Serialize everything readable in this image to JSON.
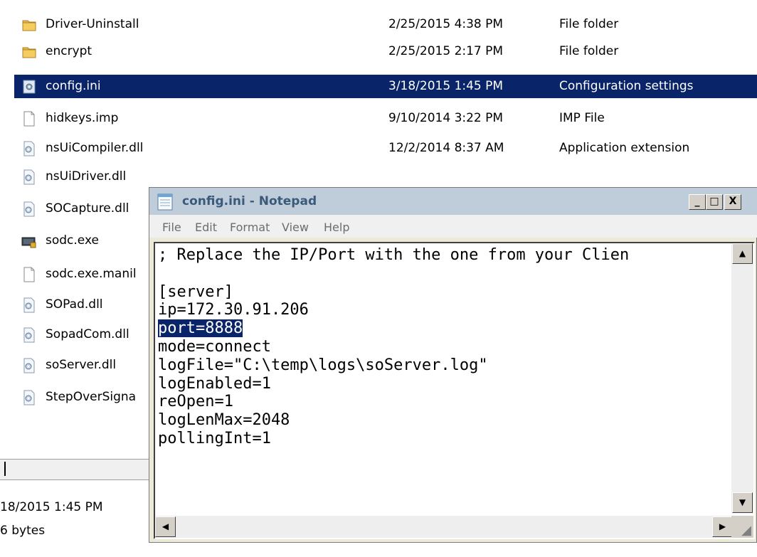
{
  "explorer": {
    "files": [
      {
        "name": "Driver-Uninstall",
        "date": "2/25/2015 4:38 PM",
        "type": "File folder",
        "icon": "folder-icon"
      },
      {
        "name": "encrypt",
        "date": "2/25/2015 2:17 PM",
        "type": "File folder",
        "icon": "folder-icon"
      },
      {
        "name": "config.ini",
        "date": "3/18/2015 1:45 PM",
        "type": "Configuration settings",
        "icon": "config-file-icon",
        "selected": true
      },
      {
        "name": "hidkeys.imp",
        "date": "9/10/2014 3:22 PM",
        "type": "IMP File",
        "icon": "blank-file-icon"
      },
      {
        "name": "nsUiCompiler.dll",
        "date": "12/2/2014 8:37 AM",
        "type": "Application extension",
        "icon": "dll-file-icon"
      },
      {
        "name": "nsUiDriver.dll",
        "date": "",
        "type": "",
        "icon": "dll-file-icon"
      },
      {
        "name": "SOCapture.dll",
        "date": "",
        "type": "",
        "icon": "dll-file-icon"
      },
      {
        "name": "sodc.exe",
        "date": "",
        "type": "",
        "icon": "exe-file-icon"
      },
      {
        "name": "sodc.exe.manil",
        "date": "",
        "type": "",
        "icon": "blank-file-icon"
      },
      {
        "name": "SOPad.dll",
        "date": "",
        "type": "",
        "icon": "dll-file-icon"
      },
      {
        "name": "SopadCom.dll",
        "date": "",
        "type": "",
        "icon": "dll-file-icon"
      },
      {
        "name": "soServer.dll",
        "date": "",
        "type": "",
        "icon": "dll-file-icon"
      },
      {
        "name": "StepOverSigna",
        "date": "",
        "type": "",
        "icon": "dll-file-icon"
      }
    ],
    "details": {
      "modified": "18/2015 1:45 PM",
      "size": "6 bytes"
    }
  },
  "notepad": {
    "title": "config.ini - Notepad",
    "menu": [
      "File",
      "Edit",
      "Format",
      "View",
      "Help"
    ],
    "lines": [
      "; Replace the IP/Port with the one from your Clien",
      "",
      "[server]",
      "ip=172.30.91.206",
      "port=8888",
      "mode=connect",
      "logFile=\"C:\\temp\\logs\\soServer.log\"",
      "logEnabled=1",
      "reOpen=1",
      "logLenMax=2048",
      "pollingInt=1"
    ],
    "selected_text": "port=8888",
    "caption_buttons": {
      "minimize": "_",
      "maximize": "□",
      "close": "X"
    }
  }
}
